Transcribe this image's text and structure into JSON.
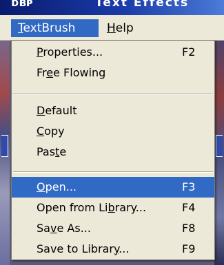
{
  "window": {
    "title_prefix": "ᴅʙᴘ",
    "title": "Text Effects"
  },
  "menubar": {
    "items": [
      {
        "label": "TextBrush",
        "mnemonic": "T",
        "active": true
      },
      {
        "label": "Help",
        "mnemonic": "H",
        "active": false
      }
    ]
  },
  "dropdown": {
    "groups": [
      [
        {
          "label": "Properties...",
          "mnemonic": "P",
          "shortcut": "F2"
        },
        {
          "label": "Free Flowing",
          "mnemonic": "e",
          "shortcut": ""
        }
      ],
      [
        {
          "label": "Default",
          "mnemonic": "D",
          "shortcut": ""
        },
        {
          "label": "Copy",
          "mnemonic": "C",
          "shortcut": ""
        },
        {
          "label": "Paste",
          "mnemonic": "t",
          "shortcut": ""
        }
      ],
      [
        {
          "label": "Open...",
          "mnemonic": "O",
          "shortcut": "F3",
          "selected": true
        },
        {
          "label": "Open from Library...",
          "mnemonic": "b",
          "shortcut": "F4"
        },
        {
          "label": "Save As...",
          "mnemonic": "v",
          "shortcut": "F8"
        },
        {
          "label": "Save to Library...",
          "mnemonic": "y",
          "shortcut": "F9"
        }
      ]
    ]
  },
  "colors": {
    "menu_background": "#ece9d8",
    "highlight": "#316ac5",
    "title_bar": "#1a3ba8"
  }
}
